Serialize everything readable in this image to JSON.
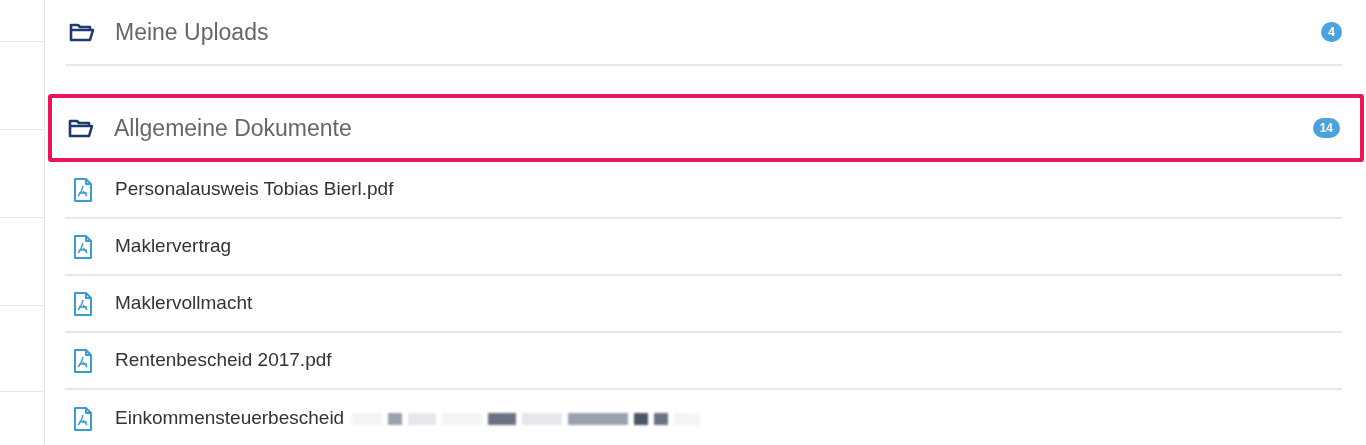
{
  "folders": [
    {
      "label": "Meine Uploads",
      "count": "4",
      "highlighted": false
    },
    {
      "label": "Allgemeine Dokumente",
      "count": "14",
      "highlighted": true
    }
  ],
  "files": [
    {
      "name": "Personalausweis Tobias Bierl.pdf",
      "redacted": false
    },
    {
      "name": "Maklervertrag",
      "redacted": false
    },
    {
      "name": "Maklervollmacht",
      "redacted": false
    },
    {
      "name": "Rentenbescheid 2017.pdf",
      "redacted": false
    },
    {
      "name": "Einkommensteuerbescheid",
      "redacted": true
    }
  ]
}
